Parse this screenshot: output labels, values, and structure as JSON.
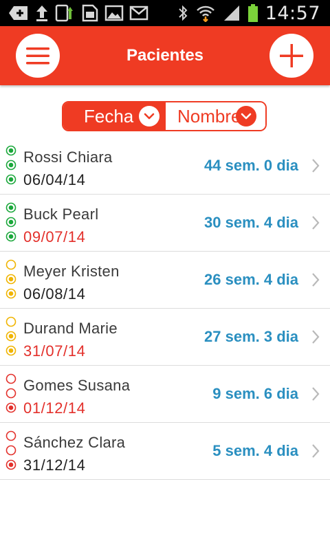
{
  "status_bar": {
    "time": "14:57"
  },
  "header": {
    "title": "Pacientes",
    "menu_icon": "menu-icon",
    "add_icon": "plus-icon"
  },
  "colors": {
    "accent": "#ef3b23",
    "weeks_blue": "#2a8fc0",
    "green": "#1aa73a",
    "yellow": "#f0b400",
    "red": "#e3302b",
    "date_dark": "#222222",
    "date_red": "#e3302b"
  },
  "sort": {
    "date_label": "Fecha",
    "name_label": "Nombre",
    "selected": "Fecha"
  },
  "patients": [
    {
      "name": "Rossi Chiara",
      "date": "06/04/14",
      "date_alert": false,
      "weeks": "44 sem. 0 dia",
      "status_color": "green",
      "levels": [
        1,
        1,
        1
      ]
    },
    {
      "name": "Buck Pearl",
      "date": "09/07/14",
      "date_alert": true,
      "weeks": "30 sem. 4 dia",
      "status_color": "green",
      "levels": [
        1,
        1,
        1
      ]
    },
    {
      "name": "Meyer Kristen",
      "date": "06/08/14",
      "date_alert": false,
      "weeks": "26 sem. 4 dia",
      "status_color": "yellow",
      "levels": [
        0,
        1,
        1
      ]
    },
    {
      "name": "Durand Marie",
      "date": "31/07/14",
      "date_alert": true,
      "weeks": "27 sem. 3 dia",
      "status_color": "yellow",
      "levels": [
        0,
        1,
        1
      ]
    },
    {
      "name": "Gomes Susana",
      "date": "01/12/14",
      "date_alert": true,
      "weeks": "9 sem. 6 dia",
      "status_color": "red",
      "levels": [
        0,
        0,
        1
      ]
    },
    {
      "name": "Sánchez Clara",
      "date": "31/12/14",
      "date_alert": false,
      "weeks": "5 sem. 4 dia",
      "status_color": "red",
      "levels": [
        0,
        0,
        1
      ]
    }
  ]
}
